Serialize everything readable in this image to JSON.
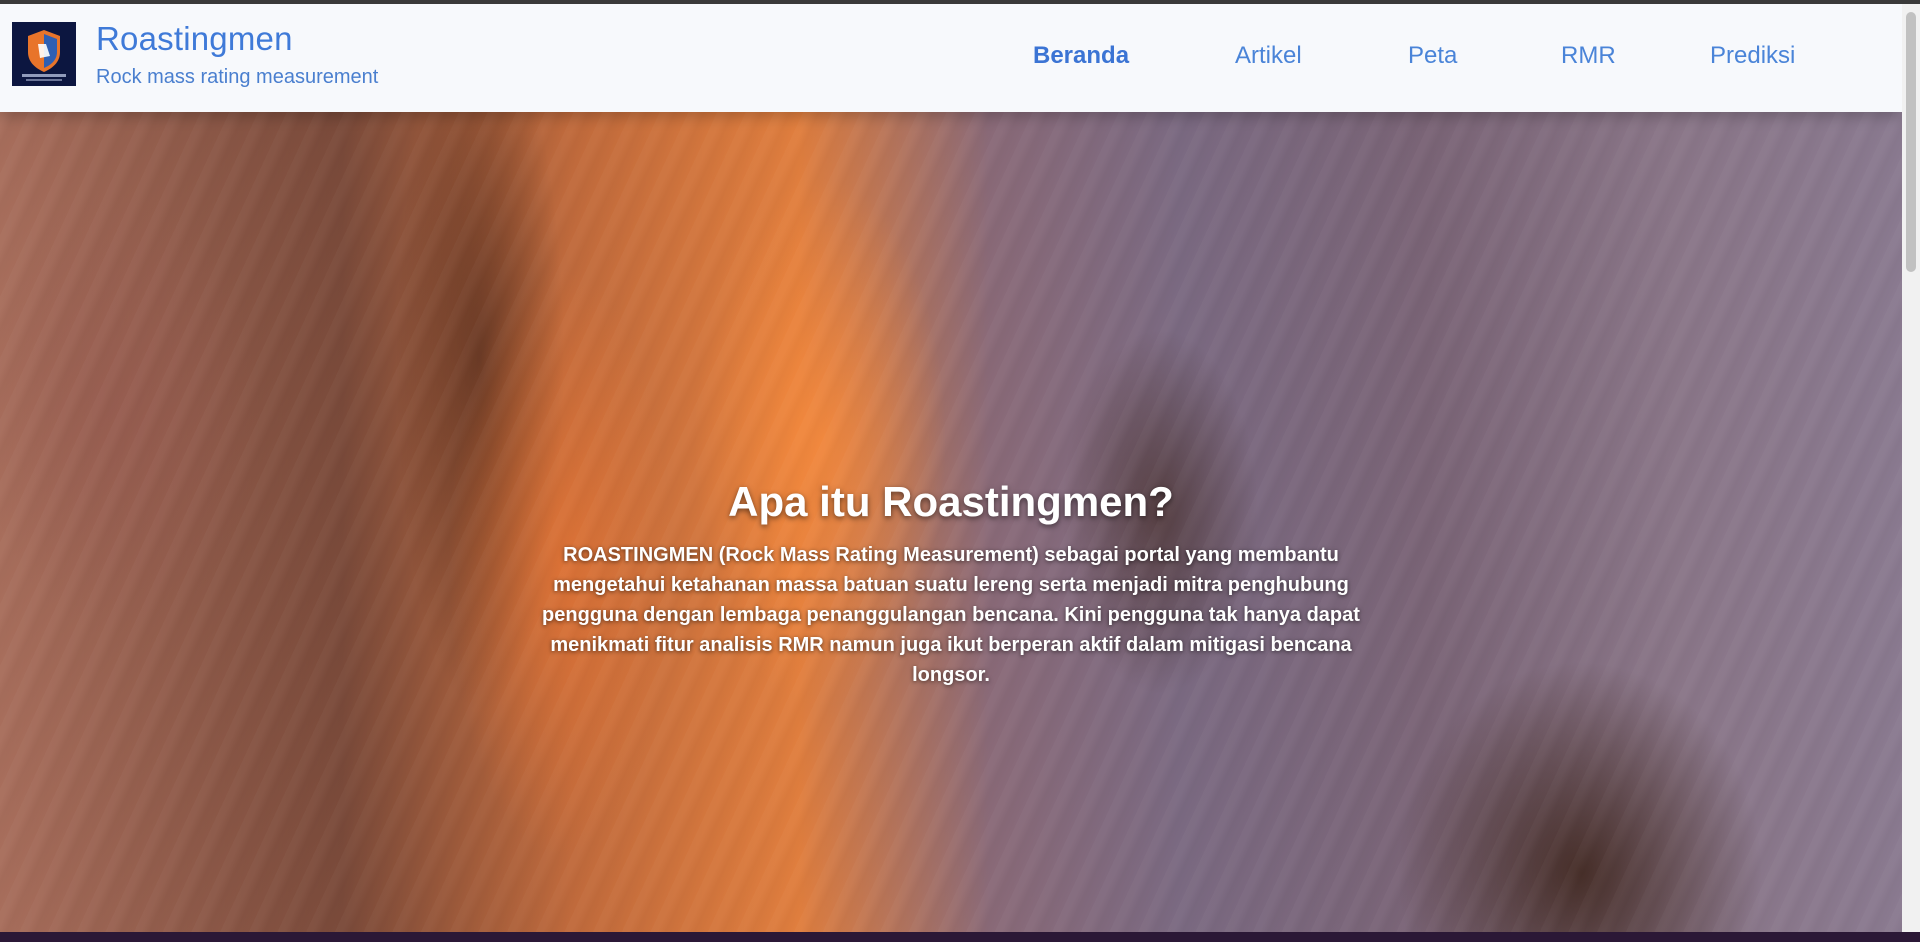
{
  "header": {
    "brand_title": "Roastingmen",
    "brand_subtitle": "Rock mass rating measurement",
    "logo_text": "ROASTINGMEN"
  },
  "nav": {
    "items": [
      {
        "label": "Beranda",
        "active": true
      },
      {
        "label": "Artikel",
        "active": false
      },
      {
        "label": "Peta",
        "active": false
      },
      {
        "label": "RMR",
        "active": false
      },
      {
        "label": "Prediksi",
        "active": false
      }
    ]
  },
  "hero": {
    "title": "Apa itu Roastingmen?",
    "description": "ROASTINGMEN (Rock Mass Rating Measurement) sebagai portal yang membantu mengetahui ketahanan massa batuan suatu lereng serta menjadi mitra penghubung pengguna dengan lembaga penanggulangan bencana. Kini pengguna tak hanya dapat menikmati fitur analisis RMR namun juga ikut berperan aktif dalam mitigasi bencana longsor."
  },
  "colors": {
    "brand_blue": "#3f7ad8",
    "header_bg": "#f7f9fc",
    "logo_bg": "#0c1640"
  }
}
